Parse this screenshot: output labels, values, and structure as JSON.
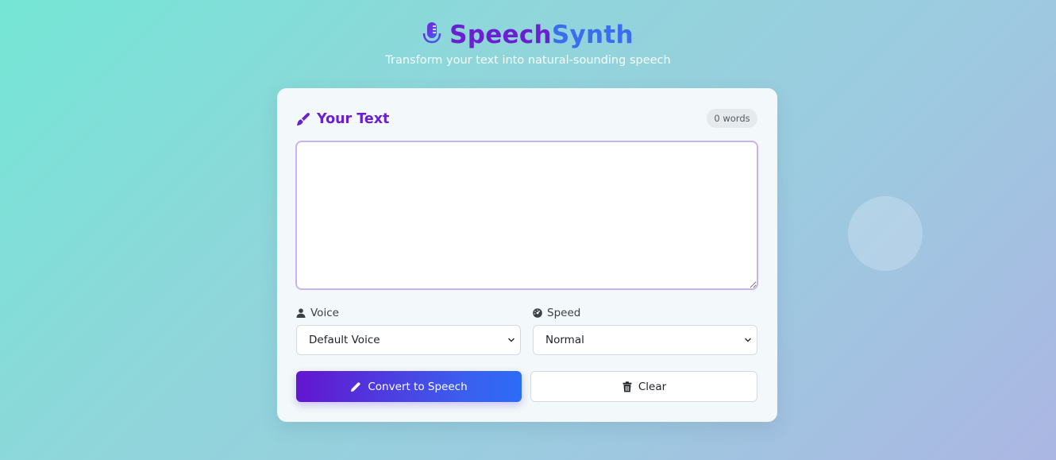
{
  "app": {
    "title_part1": "Speech",
    "title_part2": "Synth",
    "tagline": "Transform your text into natural-sounding speech"
  },
  "editor": {
    "heading": "Your Text",
    "word_count": "0 words",
    "text_value": ""
  },
  "voice": {
    "label": "Voice",
    "selected": "Default Voice"
  },
  "speed": {
    "label": "Speed",
    "selected": "Normal"
  },
  "actions": {
    "convert_label": "Convert to Speech",
    "clear_label": "Clear"
  },
  "icons": {
    "logo": "microphone-icon",
    "editor": "pen-icon",
    "voice": "user-icon",
    "speed": "speedometer-icon",
    "convert": "pencil-icon",
    "clear": "trash-icon",
    "select_arrow": "chevron-down-icon"
  },
  "colors": {
    "primary_purple": "#6a1fd0",
    "primary_blue": "#3a6df0",
    "textarea_border": "#c9b3ee",
    "card_background": "#f3f8fa"
  }
}
